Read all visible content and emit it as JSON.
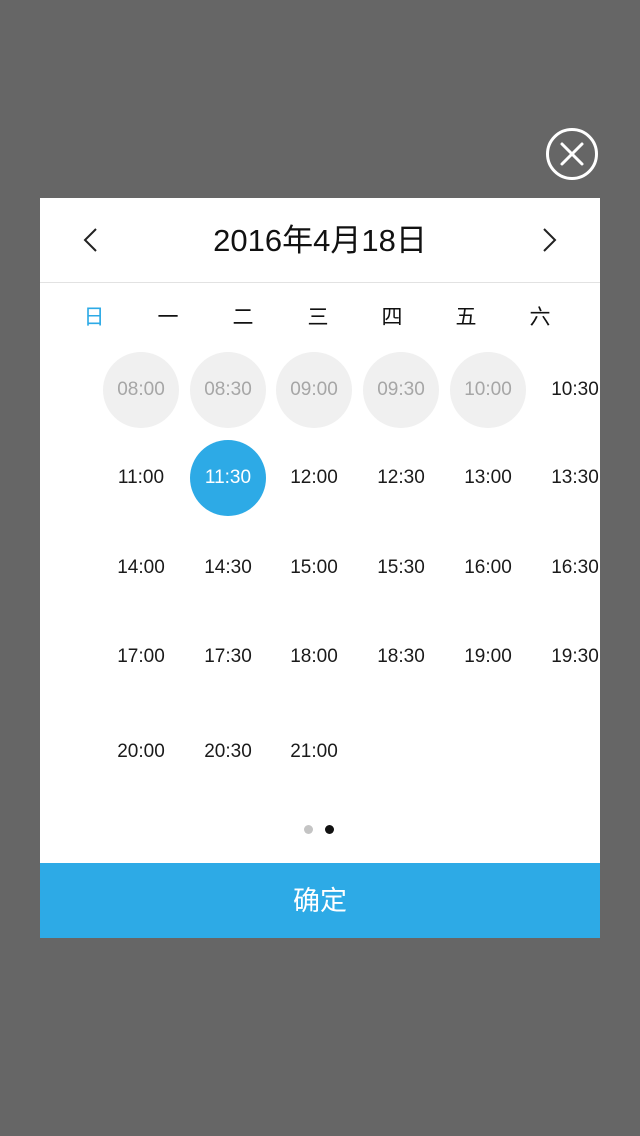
{
  "dialog": {
    "title": "2016年4月18日",
    "confirm_label": "确定"
  },
  "weekdays": [
    {
      "label": "日",
      "active": true
    },
    {
      "label": "一",
      "active": false
    },
    {
      "label": "二",
      "active": false
    },
    {
      "label": "三",
      "active": false
    },
    {
      "label": "四",
      "active": false
    },
    {
      "label": "五",
      "active": false
    },
    {
      "label": "六",
      "active": false
    }
  ],
  "time_slots": [
    {
      "time": "08:00",
      "state": "disabled"
    },
    {
      "time": "08:30",
      "state": "disabled"
    },
    {
      "time": "09:00",
      "state": "disabled"
    },
    {
      "time": "09:30",
      "state": "disabled"
    },
    {
      "time": "10:00",
      "state": "disabled"
    },
    {
      "time": "10:30",
      "state": "available"
    },
    {
      "time": "11:00",
      "state": "available"
    },
    {
      "time": "11:30",
      "state": "selected"
    },
    {
      "time": "12:00",
      "state": "available"
    },
    {
      "time": "12:30",
      "state": "available"
    },
    {
      "time": "13:00",
      "state": "available"
    },
    {
      "time": "13:30",
      "state": "available"
    },
    {
      "time": "14:00",
      "state": "available"
    },
    {
      "time": "14:30",
      "state": "available"
    },
    {
      "time": "15:00",
      "state": "available"
    },
    {
      "time": "15:30",
      "state": "available"
    },
    {
      "time": "16:00",
      "state": "available"
    },
    {
      "time": "16:30",
      "state": "available"
    },
    {
      "time": "17:00",
      "state": "available"
    },
    {
      "time": "17:30",
      "state": "available"
    },
    {
      "time": "18:00",
      "state": "available"
    },
    {
      "time": "18:30",
      "state": "available"
    },
    {
      "time": "19:00",
      "state": "available"
    },
    {
      "time": "19:30",
      "state": "available"
    },
    {
      "time": "20:00",
      "state": "available"
    },
    {
      "time": "20:30",
      "state": "available"
    },
    {
      "time": "21:00",
      "state": "available"
    }
  ],
  "pager": {
    "page_count": 2,
    "current_page": 2
  },
  "icons": {
    "close": "close-icon",
    "prev": "chevron-left-icon",
    "next": "chevron-right-icon"
  },
  "colors": {
    "accent": "#2daae6",
    "overlay": "#666666",
    "disabled_bg": "#f0f0f0",
    "disabled_text": "#a6a6a6",
    "dot_inactive": "#c4c4c4",
    "dot_active": "#111111"
  }
}
